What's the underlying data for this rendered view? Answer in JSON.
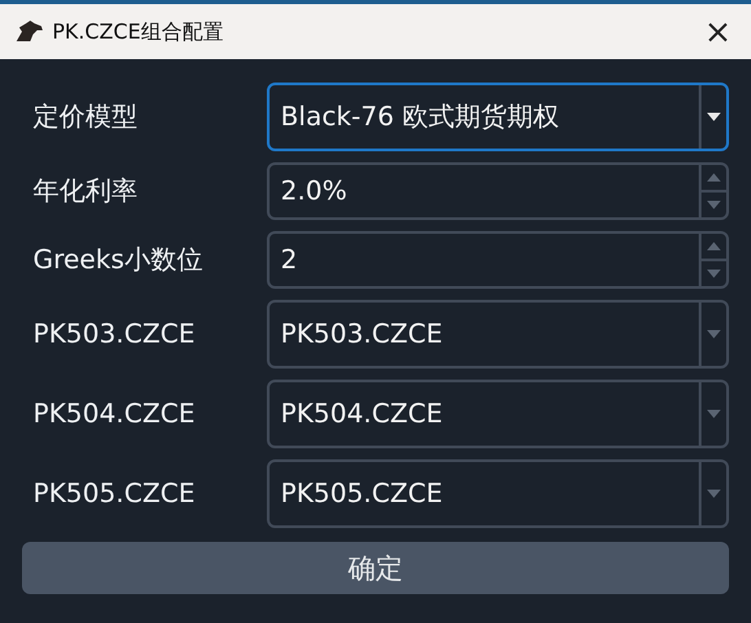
{
  "window": {
    "title": "PK.CZCE组合配置",
    "close": "×"
  },
  "fields": [
    {
      "label": "定价模型",
      "kind": "combo",
      "value": "Black-76 欧式期货期权",
      "focused": true
    },
    {
      "label": "年化利率",
      "kind": "spin",
      "value": "2.0%",
      "focused": false
    },
    {
      "label": "Greeks小数位",
      "kind": "spin",
      "value": "2",
      "focused": false
    },
    {
      "label": "PK503.CZCE",
      "kind": "combo",
      "value": "PK503.CZCE",
      "focused": false
    },
    {
      "label": "PK504.CZCE",
      "kind": "combo",
      "value": "PK504.CZCE",
      "focused": false
    },
    {
      "label": "PK505.CZCE",
      "kind": "combo",
      "value": "PK505.CZCE",
      "focused": false
    }
  ],
  "button": "确定"
}
